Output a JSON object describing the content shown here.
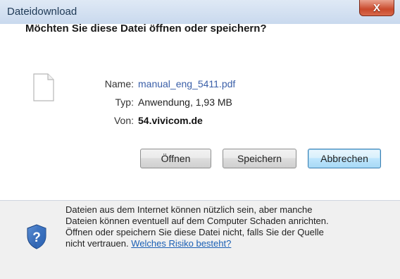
{
  "window": {
    "title": "Dateidownload",
    "close_glyph": "X"
  },
  "dialog": {
    "question": "Möchten Sie diese Datei öffnen oder speichern?",
    "file_icon": "document-icon",
    "fields": {
      "name_label": "Name:",
      "name_value": "manual_eng_5411.pdf",
      "type_label": "Typ:",
      "type_value": "Anwendung, 1,93 MB",
      "from_label": "Von:",
      "from_value": "54.vivicom.de"
    },
    "buttons": {
      "open": "Öffnen",
      "save": "Speichern",
      "cancel": "Abbrechen"
    }
  },
  "footer": {
    "icon": "shield-question-icon",
    "line1": "Dateien aus dem Internet können nützlich sein, aber manche",
    "line2": "Dateien können eventuell auf dem Computer Schaden anrichten.",
    "line3": "Öffnen oder speichern Sie diese Datei nicht, falls Sie der Quelle",
    "line4_prefix": "nicht vertrauen.",
    "risk_link": "Welches Risiko besteht?"
  },
  "colors": {
    "link": "#1a5fb4",
    "close_button": "#c9492c",
    "default_button_border": "#3c7fb1"
  }
}
